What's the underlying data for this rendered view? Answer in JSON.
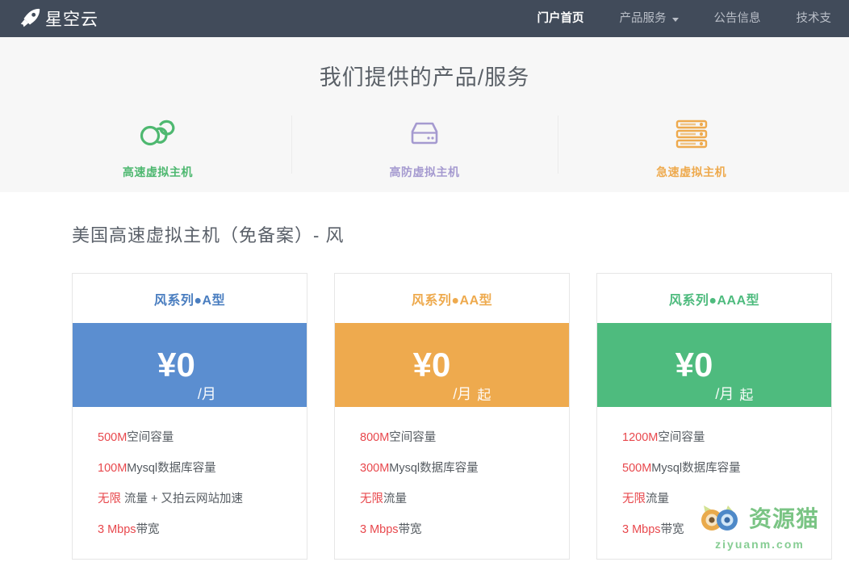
{
  "colors": {
    "navbar_bg": "#414b5a",
    "hero_bg": "#f7f7f7",
    "green": "#4eb870",
    "purple": "#a59ad0",
    "orange": "#eeaa4e",
    "blue": "#5b8ed0",
    "card_green": "#4ebb7e",
    "highlight_red": "#e8484d"
  },
  "header": {
    "logo": {
      "icon": "rocket-icon",
      "text": "星空云"
    },
    "nav": [
      {
        "label": "门户首页",
        "active": true,
        "has_caret": false
      },
      {
        "label": "产品服务",
        "active": false,
        "has_caret": true
      },
      {
        "label": "公告信息",
        "active": false,
        "has_caret": false
      },
      {
        "label": "技术支",
        "active": false,
        "has_caret": false
      }
    ]
  },
  "hero": {
    "title": "我们提供的产品/服务",
    "services": [
      {
        "icon": "cloud-icon",
        "label": "高速虚拟主机",
        "color": "#4eb870"
      },
      {
        "icon": "server-drive-icon",
        "label": "高防虚拟主机",
        "color": "#a59ad0"
      },
      {
        "icon": "server-rack-icon",
        "label": "急速虚拟主机",
        "color": "#eeaa4e"
      }
    ]
  },
  "products": {
    "title": "美国高速虚拟主机（免备案）- 风",
    "cards": [
      {
        "name": "风系列●A型",
        "accent": "#5b8ed0",
        "price": "¥0",
        "unit": "/月",
        "suffix": "",
        "features": [
          {
            "highlight": "500M",
            "rest": "空间容量"
          },
          {
            "highlight": "100M",
            "rest": "Mysql数据库容量"
          },
          {
            "highlight": "无限",
            "rest": " 流量 + 又拍云网站加速"
          },
          {
            "highlight": "3 Mbps",
            "rest": "带宽"
          }
        ]
      },
      {
        "name": "风系列●AA型",
        "accent": "#eeaa4e",
        "price": "¥0",
        "unit": "/月",
        "suffix": "起",
        "features": [
          {
            "highlight": "800M",
            "rest": "空间容量"
          },
          {
            "highlight": "300M",
            "rest": "Mysql数据库容量"
          },
          {
            "highlight": "无限",
            "rest": "流量"
          },
          {
            "highlight": "3 Mbps",
            "rest": "带宽"
          }
        ]
      },
      {
        "name": "风系列●AAA型",
        "accent": "#4ebb7e",
        "price": "¥0",
        "unit": "/月",
        "suffix": "起",
        "features": [
          {
            "highlight": "1200M",
            "rest": "空间容量"
          },
          {
            "highlight": "500M",
            "rest": "Mysql数据库容量"
          },
          {
            "highlight": "无限",
            "rest": "流量"
          },
          {
            "highlight": "3 Mbps",
            "rest": "带宽"
          }
        ]
      }
    ]
  },
  "watermark": {
    "icon": "cat-face-logo",
    "text": "资源猫",
    "url": "ziyuanm.com"
  }
}
